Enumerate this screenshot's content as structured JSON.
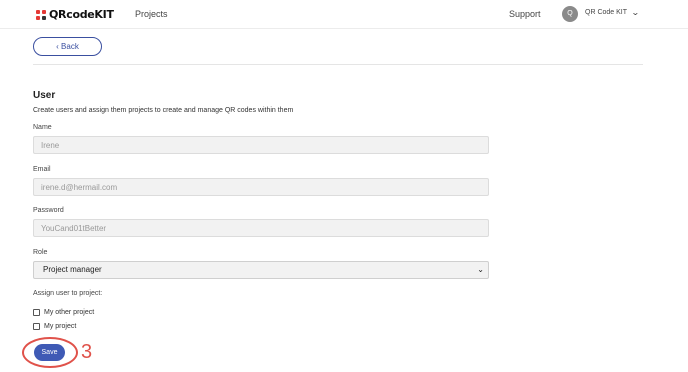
{
  "header": {
    "logo_text": "QRcodeKIT",
    "nav_projects": "Projects",
    "nav_support": "Support",
    "avatar_initial": "Q",
    "account_name": "QR Code KIT",
    "chevron_icon": "chevron-down-icon"
  },
  "back_label": "‹ Back",
  "section": {
    "title": "User",
    "description": "Create users and assign them projects to create and manage QR codes within them"
  },
  "fields": {
    "name_label": "Name",
    "name_value": "Irene",
    "email_label": "Email",
    "email_value": "irene.d@hermail.com",
    "password_label": "Password",
    "password_value": "YouCand01tBetter",
    "role_label": "Role",
    "role_value": "Project manager"
  },
  "assign": {
    "label": "Assign user to project:",
    "projects": [
      {
        "label": "My other project",
        "checked": false
      },
      {
        "label": "My project",
        "checked": false
      }
    ]
  },
  "save_label": "Save",
  "annotation": {
    "step_number": "3",
    "ring_color": "#e0524a"
  },
  "colors": {
    "accent": "#3f5ab5",
    "logo_red": "#e53935"
  }
}
